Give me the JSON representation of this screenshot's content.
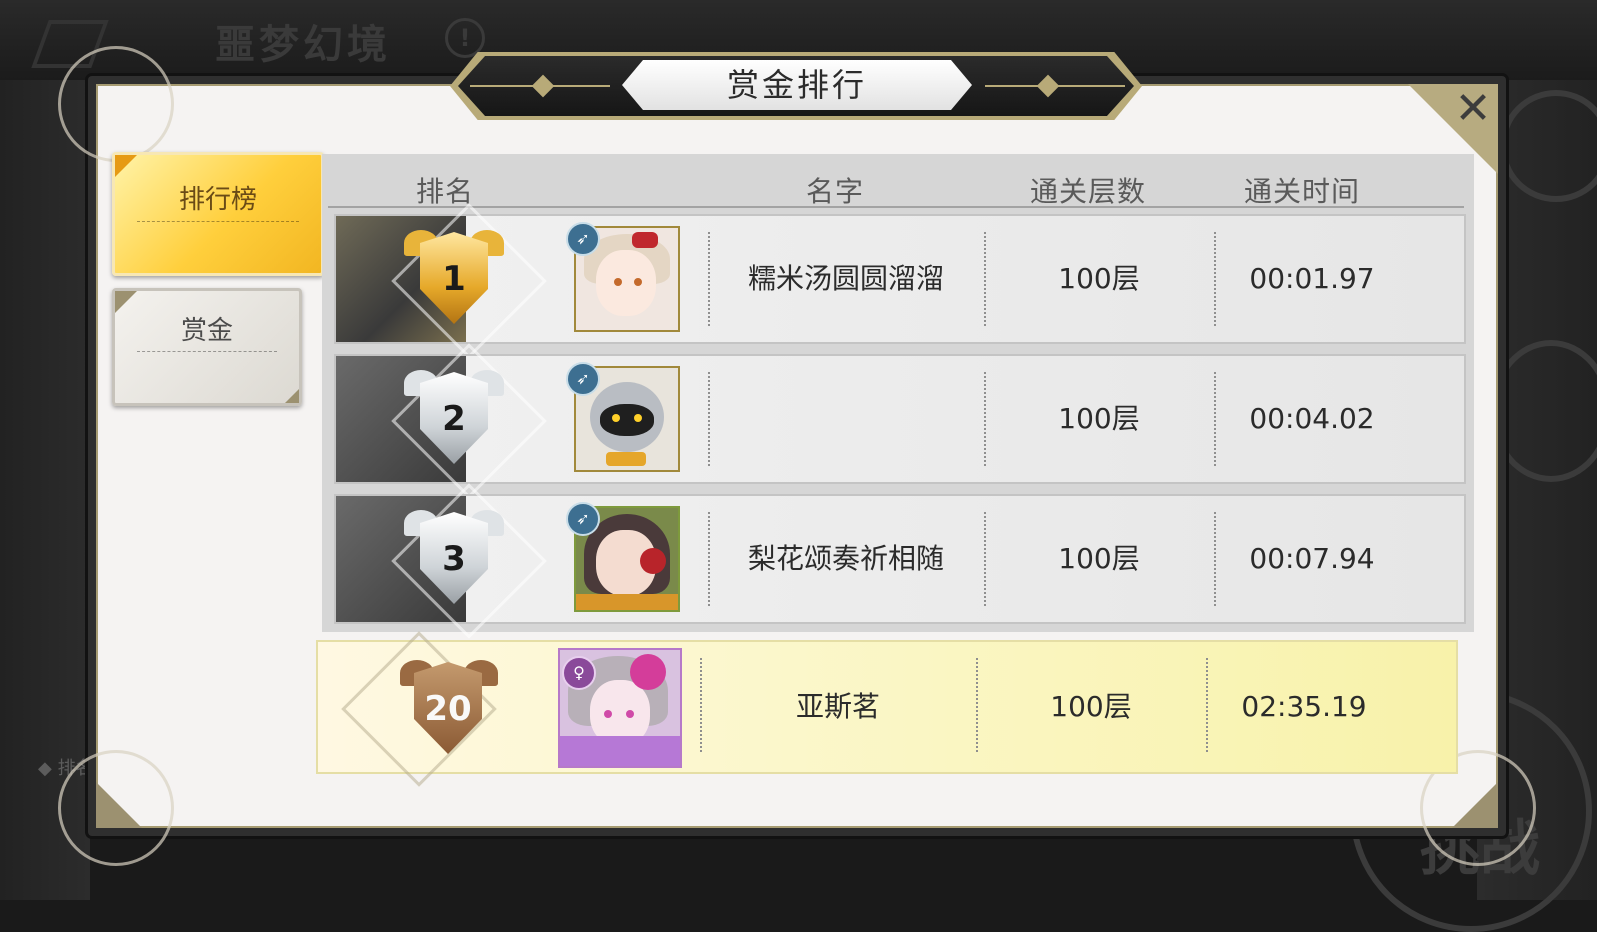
{
  "background": {
    "title": "噩梦幻境",
    "info_glyph": "!",
    "side_label": "◆ 排名",
    "challenge_label": "挑战"
  },
  "dialog": {
    "title": "赏金排行",
    "close_glyph": "✕"
  },
  "tabs": [
    {
      "label": "排行榜",
      "active": true
    },
    {
      "label": "赏金",
      "active": false
    }
  ],
  "table": {
    "columns": [
      "排名",
      "名字",
      "通关层数",
      "通关时间"
    ],
    "rows": [
      {
        "rank": "1",
        "name": "糯米汤圆圆溜溜",
        "floors": "100层",
        "time": "00:01.97",
        "badge": "gold",
        "class_icon": "bow-icon"
      },
      {
        "rank": "2",
        "name": "",
        "floors": "100层",
        "time": "00:04.02",
        "badge": "silver",
        "class_icon": "bow-icon"
      },
      {
        "rank": "3",
        "name": "梨花颂奏祈相随",
        "floors": "100层",
        "time": "00:07.94",
        "badge": "silver",
        "class_icon": "bow-icon"
      }
    ],
    "my_row": {
      "rank": "20",
      "name": "亚斯茗",
      "floors": "100层",
      "time": "02:35.19",
      "badge": "bronze",
      "class_icon": "female-symbol-icon"
    }
  },
  "icons": {
    "bow_glyph": "➶",
    "female_glyph": "♀"
  },
  "colors": {
    "accent_gold": "#b8aa78",
    "active_tab": "#ffcf3c",
    "my_row_highlight": "#fbf7cb"
  }
}
